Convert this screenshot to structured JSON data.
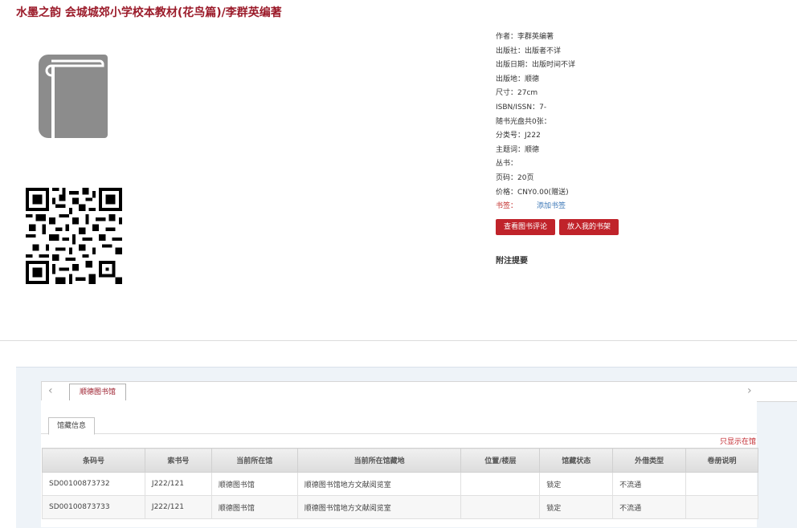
{
  "title": "水墨之韵 会城城郊小学校本教材(花鸟篇)/李群英编著",
  "info": {
    "author": "作者：李群英编著",
    "publisher": "出版社：出版者不详",
    "pub_date": "出版日期：出版时间不详",
    "pub_place": "出版地：顺德",
    "size": "尺寸：27cm",
    "isbn": "ISBN/ISSN：7-",
    "cd": "随书光盘共0张：",
    "class_no": "分类号：J222",
    "subject": "主题词：顺德",
    "series": "丛书：",
    "pages": "页码：20页",
    "price": "价格：CNY0.00(赠送)",
    "tag_label": "书签：",
    "tag_link": "添加书签"
  },
  "buttons": {
    "review": "查看图书评论",
    "shelf": "放入我的书架"
  },
  "note_label": "附注提要",
  "tabs": {
    "prev_arrow": "‹",
    "next_arrow": "›",
    "library": "顺德图书馆",
    "holdings": "馆藏信息"
  },
  "show_link": "只显示在馆",
  "table": {
    "headers": [
      "条码号",
      "索书号",
      "当前所在馆",
      "当前所在馆藏地",
      "位置/楼层",
      "馆藏状态",
      "外借类型",
      "卷册说明"
    ],
    "rows": [
      [
        "SD00100873732",
        "J222/121",
        "顺德图书馆",
        "顺德图书馆地方文献阅览室",
        "",
        "锁定",
        "不流通",
        ""
      ],
      [
        "SD00100873733",
        "J222/121",
        "顺德图书馆",
        "顺德图书馆地方文献阅览室",
        "",
        "锁定",
        "不流通",
        ""
      ]
    ]
  },
  "colors": {
    "accent": "#c0232a",
    "title": "#9b1b2a",
    "link": "#3a76b6",
    "cover_gray": "#8c8c8c"
  },
  "icons": {
    "cover": "book-icon",
    "qr": "qr-code-icon"
  }
}
